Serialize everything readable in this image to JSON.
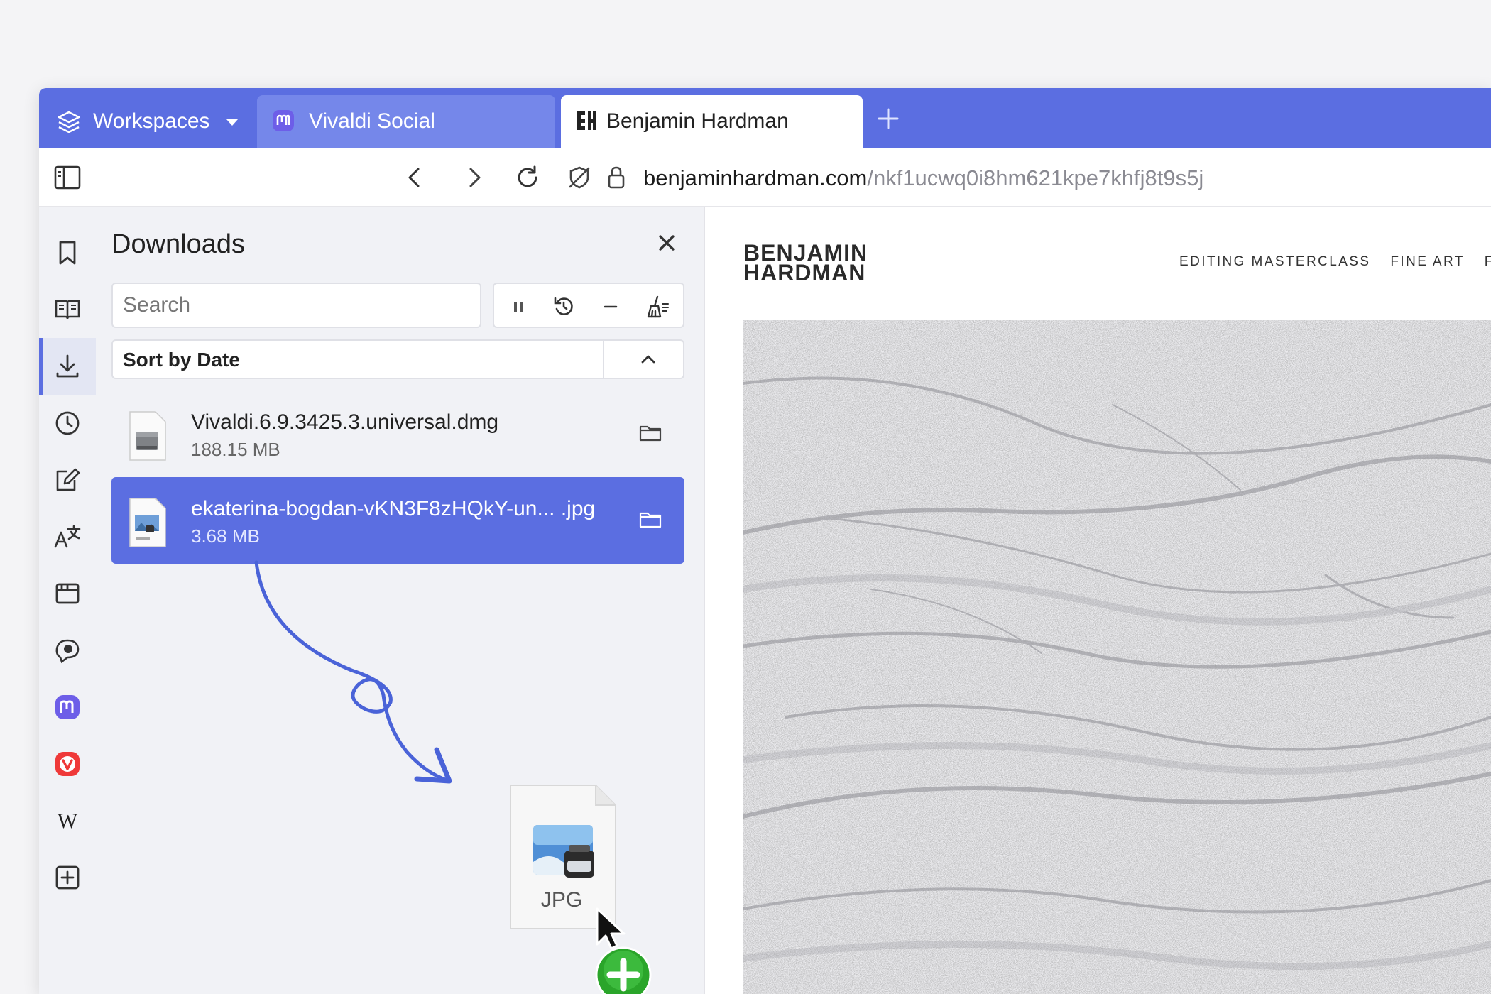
{
  "colors": {
    "accent": "#5b6ee1",
    "tab_inactive": "#7587ea",
    "panel_bg": "#f1f2f6",
    "add_badge": "#2aa52a"
  },
  "tabs": {
    "workspaces_label": "Workspaces",
    "items": [
      {
        "label": "Vivaldi Social",
        "icon": "mastodon-icon",
        "active": false
      },
      {
        "label": "Benjamin Hardman",
        "icon": "bh-site-icon",
        "active": true
      }
    ]
  },
  "address": {
    "host": "benjaminhardman.com",
    "path": "/nkf1ucwq0i8hm621kpe7khfj8t9s5j"
  },
  "sidebar_icons": [
    "bookmark-icon",
    "reading-list-icon",
    "downloads-icon",
    "history-icon",
    "notes-icon",
    "translate-icon",
    "window-icon",
    "feed-reader-icon",
    "mastodon-panel-icon",
    "vivaldi-panel-icon",
    "wikipedia-panel-icon",
    "add-panel-icon"
  ],
  "downloads": {
    "title": "Downloads",
    "search_placeholder": "Search",
    "sort_label": "Sort by Date",
    "items": [
      {
        "name": "Vivaldi.6.9.3425.3.universal.dmg",
        "size": "188.15 MB",
        "selected": false
      },
      {
        "name": "ekaterina-bogdan-vKN3F8zHQkY-un... .jpg",
        "size": "3.68 MB",
        "selected": true
      }
    ]
  },
  "drag": {
    "file_type": "JPG"
  },
  "site": {
    "brand_line1": "BENJAMIN",
    "brand_line2": "HARDMAN",
    "nav": [
      "EDITING MASTERCLASS",
      "FINE ART",
      "FI"
    ]
  }
}
